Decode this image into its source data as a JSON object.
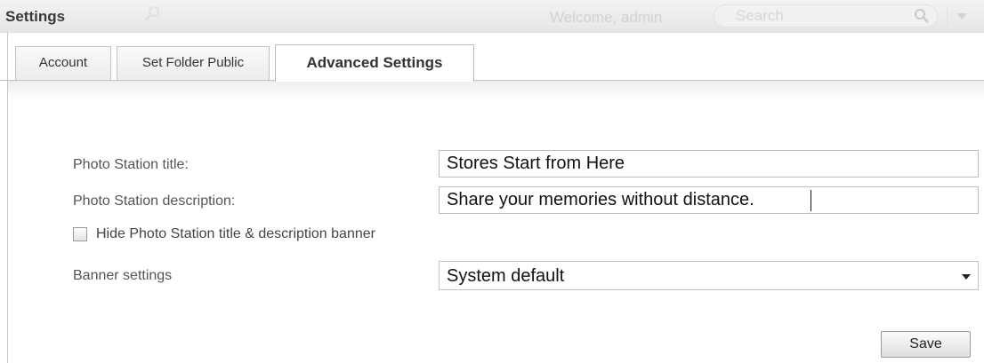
{
  "window": {
    "title": "Settings",
    "welcome_text": "Welcome, admin",
    "search": {
      "placeholder": "Search",
      "value": ""
    }
  },
  "tabs": [
    {
      "label": "Account",
      "active": false
    },
    {
      "label": "Set Folder Public",
      "active": false
    },
    {
      "label": "Advanced Settings",
      "active": true
    }
  ],
  "form": {
    "title_label": "Photo Station title:",
    "title_value": "Stores Start from Here",
    "description_label": "Photo Station description:",
    "description_value": "Share your memories without distance.",
    "hide_banner_label": "Hide Photo Station title & description banner",
    "hide_banner_checked": false,
    "banner_label": "Banner settings",
    "banner_value": "System default",
    "save_label": "Save"
  },
  "icons": {
    "header_ghost": "key-icon",
    "search": "search-icon",
    "menu": "chevron-down-icon",
    "select": "chevron-down-icon"
  }
}
